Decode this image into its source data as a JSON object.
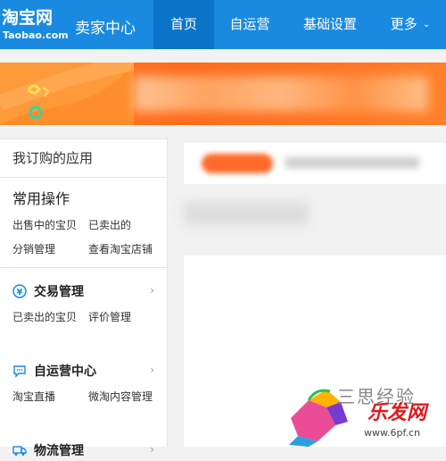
{
  "header": {
    "logo_main": "淘宝网",
    "logo_sub": "Taobao.com",
    "title": "卖家中心",
    "nav": [
      {
        "label": "首页",
        "active": true
      },
      {
        "label": "自运营",
        "active": false
      },
      {
        "label": "基础设置",
        "active": false
      },
      {
        "label": "更多",
        "active": false
      }
    ],
    "colors": {
      "bar": "#1a8ae0",
      "active": "#0a74c8"
    }
  },
  "sidebar": {
    "heading": "我订购的应用",
    "common_title": "常用操作",
    "common_links_row1": [
      "出售中的宝贝",
      "已卖出的"
    ],
    "common_links_row2": [
      "分销管理",
      "查看淘宝店铺"
    ],
    "groups": [
      {
        "title": "交易管理",
        "icon": "yuan-icon",
        "links": [
          "已卖出的宝贝",
          "评价管理"
        ]
      },
      {
        "title": "自运营中心",
        "icon": "chat-icon",
        "links": [
          "淘宝直播",
          "微淘内容管理"
        ]
      },
      {
        "title": "物流管理",
        "icon": "truck-icon",
        "links": []
      }
    ]
  },
  "watermark": {
    "text_gray": "三思经验",
    "text_red": "乐发网",
    "url": "www.6pf.cn"
  }
}
